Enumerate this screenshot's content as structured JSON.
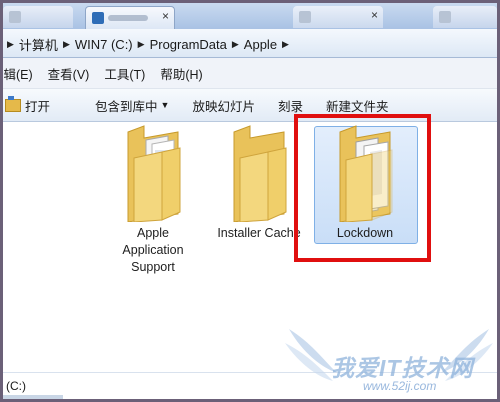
{
  "tabs": [
    "",
    "",
    "",
    ""
  ],
  "address": {
    "crumbs": [
      "计算机",
      "WIN7 (C:)",
      "ProgramData",
      "Apple"
    ]
  },
  "menu": {
    "edit": "编辑(E)",
    "view": "查看(V)",
    "tools": "工具(T)",
    "help": "帮助(H)"
  },
  "toolbar": {
    "open": "打开",
    "include_library": "包含到库中",
    "slideshow": "放映幻灯片",
    "burn": "刻录",
    "new_folder": "新建文件夹"
  },
  "folders": [
    {
      "label_lines": [
        "Apple",
        "Application",
        "Support"
      ]
    },
    {
      "label_lines": [
        "Installer Cache"
      ]
    },
    {
      "label_lines": [
        "Lockdown"
      ],
      "selected": true
    }
  ],
  "nav": {
    "drive": "(C:)"
  },
  "watermark": {
    "title": "我爱IT技术网",
    "url": "www.52ij.com"
  },
  "colors": {
    "highlight": "#e00f0f",
    "selection": "#c9def7",
    "folder": "#f1d27a"
  }
}
